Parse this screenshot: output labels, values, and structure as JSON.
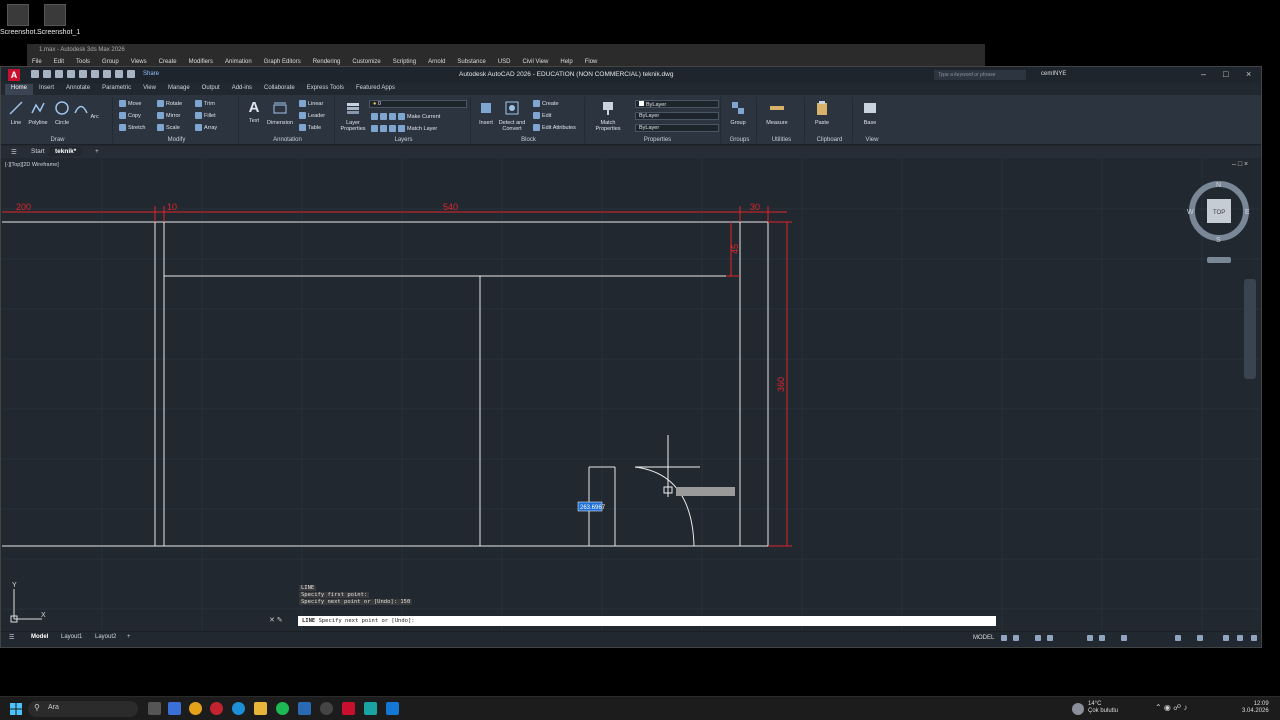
{
  "desktop": {
    "icons": [
      {
        "label": "Screenshot..."
      },
      {
        "label": "Screenshot_1"
      }
    ]
  },
  "max_window": {
    "title": "1.max - Autodesk 3ds Max 2026",
    "menu": [
      "File",
      "Edit",
      "Tools",
      "Group",
      "Views",
      "Create",
      "Modifiers",
      "Animation",
      "Graph Editors",
      "Rendering",
      "Customize",
      "Scripting",
      "Arnold",
      "Substance",
      "USD",
      "Civil View",
      "Help",
      "Flow"
    ]
  },
  "autocad": {
    "title": "Autodesk AutoCAD 2026 - EDUCATION (NON COMMERCIAL)    teknik.dwg",
    "search_placeholder": "Type a keyword or phrase",
    "user": "cemINYE",
    "share": "Share",
    "ribbon_tabs": [
      "Home",
      "Insert",
      "Annotate",
      "Parametric",
      "View",
      "Manage",
      "Output",
      "Add-ins",
      "Collaborate",
      "Express Tools",
      "Featured Apps"
    ],
    "draw": {
      "line": "Line",
      "polyline": "Polyline",
      "circle": "Circle",
      "arc": "Arc",
      "title": "Draw"
    },
    "modify": {
      "move": "Move",
      "rotate": "Rotate",
      "trim": "Trim",
      "copy": "Copy",
      "mirror": "Mirror",
      "fillet": "Fillet",
      "stretch": "Stretch",
      "scale": "Scale",
      "array": "Array",
      "title": "Modify"
    },
    "annotation": {
      "text": "Text",
      "dimension": "Dimension",
      "linear": "Linear",
      "leader": "Leader",
      "table": "Table",
      "title": "Annotation"
    },
    "layers": {
      "layer_properties": "Layer Properties",
      "current_layer": "0",
      "make_current": "Make Current",
      "match_layer": "Match Layer",
      "title": "Layers"
    },
    "block": {
      "insert": "Insert",
      "detect": "Detect and Convert",
      "create": "Create",
      "edit": "Edit",
      "edit_attr": "Edit Attributes",
      "title": "Block"
    },
    "properties": {
      "match": "Match Properties",
      "bylayer1": "ByLayer",
      "bylayer2": "ByLayer",
      "bylayer3": "ByLayer",
      "title": "Properties"
    },
    "groups": {
      "group": "Group",
      "title": "Groups"
    },
    "utilities": {
      "measure": "Measure",
      "title": "Utilities"
    },
    "clipboard": {
      "paste": "Paste",
      "title": "Clipboard"
    },
    "view": {
      "base": "Base",
      "title": "View"
    },
    "file_tabs": [
      "Start",
      "teknik*"
    ],
    "viewport_label": "[-][Top][2D Wireframe]",
    "viewcube": {
      "top": "TOP",
      "n": "N",
      "s": "S",
      "e": "E",
      "w": "W"
    },
    "dims": {
      "d200": "200",
      "d10": "10",
      "d540": "540",
      "d30": "30",
      "d45": "45",
      "d360": "360"
    },
    "dynamic_input": "263.6967",
    "command_history": [
      "LINE",
      "Specify first point:",
      "Specify next point or [Undo]: 150"
    ],
    "command_line": {
      "cmd": "LINE",
      "prompt": "Specify next point or [Undo]:"
    },
    "layout_tabs": [
      "Model",
      "Layout1",
      "Layout2"
    ],
    "status_model": "MODEL"
  },
  "taskbar": {
    "search": "Ara",
    "weather_temp": "14°C",
    "weather_desc": "Çok bulutlu",
    "time": "12:09",
    "date": "3.04.2026"
  }
}
